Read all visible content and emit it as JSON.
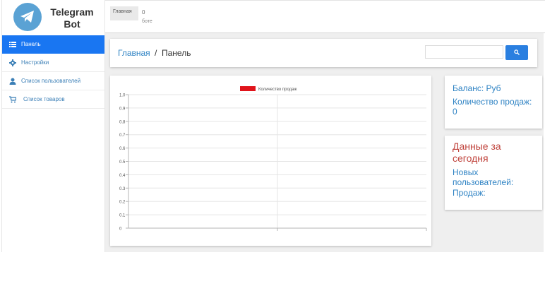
{
  "brand": {
    "line1": "Telegram",
    "line2": "Bot",
    "logo_icon": "telegram-plane-icon"
  },
  "sidebar": {
    "items": [
      {
        "label": "Панель",
        "icon": "list-icon",
        "active": true
      },
      {
        "label": "Настройки",
        "icon": "gear-icon",
        "active": false
      },
      {
        "label": "Список пользователей",
        "icon": "user-icon",
        "active": false
      },
      {
        "label": "Список товаров",
        "icon": "cart-icon",
        "active": false
      }
    ]
  },
  "topbar": {
    "crumb": "Главная",
    "count": "0",
    "sub": "боте"
  },
  "breadcrumb": {
    "home": "Главная",
    "separator": "/",
    "current": "Панель"
  },
  "search": {
    "placeholder": "",
    "value": "",
    "button_icon": "search-icon"
  },
  "stats": {
    "balance": "Баланс: Руб",
    "sales": "Количество продаж: 0"
  },
  "today": {
    "title": "Данные за сегодня",
    "new_users": "Новых пользователей:",
    "sales": "Продаж:"
  },
  "colors": {
    "accent": "#1976f2",
    "link": "#2f83c4",
    "today_title": "#c0443d",
    "series": "#e0141b"
  },
  "chart_data": {
    "type": "bar",
    "categories": [],
    "series": [
      {
        "name": "Количество продаж",
        "values": []
      }
    ],
    "title": "",
    "xlabel": "",
    "ylabel": "",
    "ylim": [
      0,
      1.0
    ],
    "yticks": [
      "0",
      "0.1",
      "0.2",
      "0.3",
      "0.4",
      "0.5",
      "0.6",
      "0.7",
      "0.8",
      "0.9",
      "1.0"
    ],
    "grid": true,
    "legend": "top-center"
  }
}
